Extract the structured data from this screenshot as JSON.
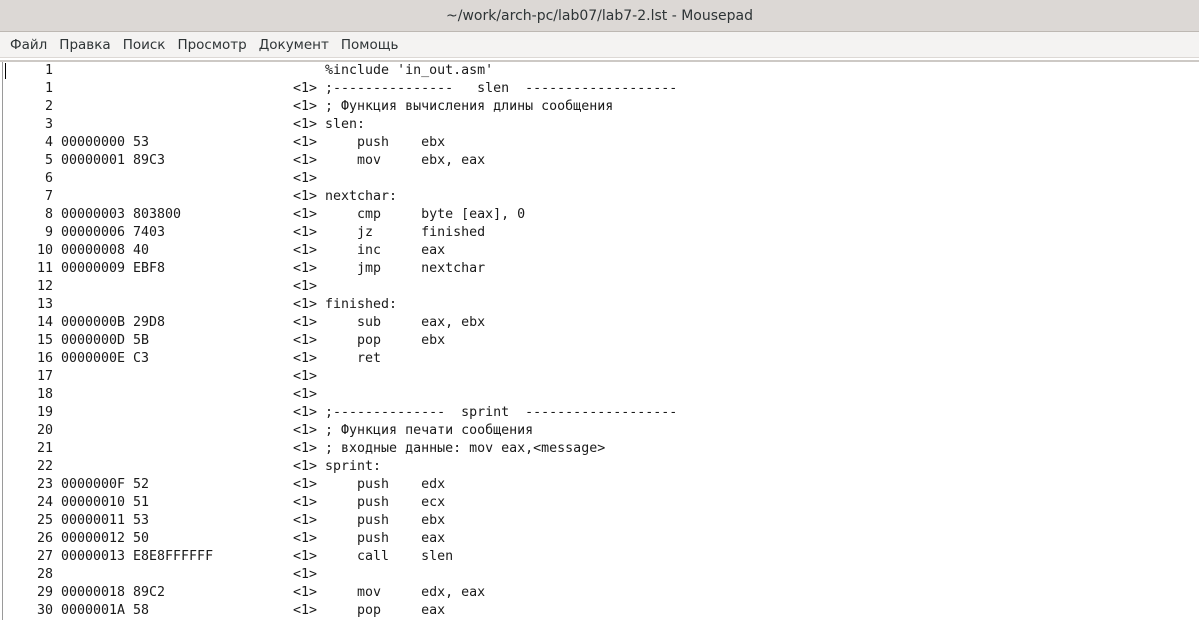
{
  "window": {
    "title": "~/work/arch-pc/lab07/lab7-2.lst - Mousepad"
  },
  "menu": [
    "Файл",
    "Правка",
    "Поиск",
    "Просмотр",
    "Документ",
    "Помощь"
  ],
  "lines": [
    {
      "num": "1",
      "addr": "",
      "hex": "",
      "marker": "",
      "src": "%include 'in_out.asm'"
    },
    {
      "num": "1",
      "addr": "",
      "hex": "",
      "marker": "<1>",
      "src": ";---------------   slen  -------------------"
    },
    {
      "num": "2",
      "addr": "",
      "hex": "",
      "marker": "<1>",
      "src": "; Функция вычисления длины сообщения"
    },
    {
      "num": "3",
      "addr": "",
      "hex": "",
      "marker": "<1>",
      "src": "slen:"
    },
    {
      "num": "4",
      "addr": "00000000",
      "hex": "53",
      "marker": "<1>",
      "src": "    push    ebx"
    },
    {
      "num": "5",
      "addr": "00000001",
      "hex": "89C3",
      "marker": "<1>",
      "src": "    mov     ebx, eax"
    },
    {
      "num": "6",
      "addr": "",
      "hex": "",
      "marker": "<1>",
      "src": ""
    },
    {
      "num": "7",
      "addr": "",
      "hex": "",
      "marker": "<1>",
      "src": "nextchar:"
    },
    {
      "num": "8",
      "addr": "00000003",
      "hex": "803800",
      "marker": "<1>",
      "src": "    cmp     byte [eax], 0"
    },
    {
      "num": "9",
      "addr": "00000006",
      "hex": "7403",
      "marker": "<1>",
      "src": "    jz      finished"
    },
    {
      "num": "10",
      "addr": "00000008",
      "hex": "40",
      "marker": "<1>",
      "src": "    inc     eax"
    },
    {
      "num": "11",
      "addr": "00000009",
      "hex": "EBF8",
      "marker": "<1>",
      "src": "    jmp     nextchar"
    },
    {
      "num": "12",
      "addr": "",
      "hex": "",
      "marker": "<1>",
      "src": ""
    },
    {
      "num": "13",
      "addr": "",
      "hex": "",
      "marker": "<1>",
      "src": "finished:"
    },
    {
      "num": "14",
      "addr": "0000000B",
      "hex": "29D8",
      "marker": "<1>",
      "src": "    sub     eax, ebx"
    },
    {
      "num": "15",
      "addr": "0000000D",
      "hex": "5B",
      "marker": "<1>",
      "src": "    pop     ebx"
    },
    {
      "num": "16",
      "addr": "0000000E",
      "hex": "C3",
      "marker": "<1>",
      "src": "    ret"
    },
    {
      "num": "17",
      "addr": "",
      "hex": "",
      "marker": "<1>",
      "src": ""
    },
    {
      "num": "18",
      "addr": "",
      "hex": "",
      "marker": "<1>",
      "src": ""
    },
    {
      "num": "19",
      "addr": "",
      "hex": "",
      "marker": "<1>",
      "src": ";--------------  sprint  -------------------"
    },
    {
      "num": "20",
      "addr": "",
      "hex": "",
      "marker": "<1>",
      "src": "; Функция печати сообщения"
    },
    {
      "num": "21",
      "addr": "",
      "hex": "",
      "marker": "<1>",
      "src": "; входные данные: mov eax,<message>"
    },
    {
      "num": "22",
      "addr": "",
      "hex": "",
      "marker": "<1>",
      "src": "sprint:"
    },
    {
      "num": "23",
      "addr": "0000000F",
      "hex": "52",
      "marker": "<1>",
      "src": "    push    edx"
    },
    {
      "num": "24",
      "addr": "00000010",
      "hex": "51",
      "marker": "<1>",
      "src": "    push    ecx"
    },
    {
      "num": "25",
      "addr": "00000011",
      "hex": "53",
      "marker": "<1>",
      "src": "    push    ebx"
    },
    {
      "num": "26",
      "addr": "00000012",
      "hex": "50",
      "marker": "<1>",
      "src": "    push    eax"
    },
    {
      "num": "27",
      "addr": "00000013",
      "hex": "E8E8FFFFFF",
      "marker": "<1>",
      "src": "    call    slen"
    },
    {
      "num": "28",
      "addr": "",
      "hex": "",
      "marker": "<1>",
      "src": ""
    },
    {
      "num": "29",
      "addr": "00000018",
      "hex": "89C2",
      "marker": "<1>",
      "src": "    mov     edx, eax"
    },
    {
      "num": "30",
      "addr": "0000001A",
      "hex": "58",
      "marker": "<1>",
      "src": "    pop     eax"
    }
  ]
}
